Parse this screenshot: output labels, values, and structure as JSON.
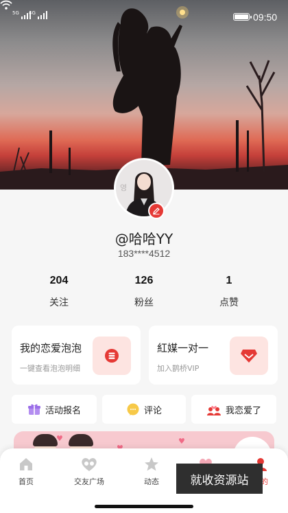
{
  "status_bar": {
    "network_1": "5G",
    "network_2": "4G",
    "time": "09:50"
  },
  "profile": {
    "username": "@哈哈YY",
    "phone": "183****4512"
  },
  "stats": [
    {
      "value": "204",
      "label": "关注"
    },
    {
      "value": "126",
      "label": "粉丝"
    },
    {
      "value": "1",
      "label": "点赞"
    }
  ],
  "cards": [
    {
      "title": "我的恋爱泡泡",
      "subtitle": "一键查看泡泡明细",
      "icon": "coin-stack-icon"
    },
    {
      "title": "紅媒一对一",
      "subtitle": "加入鹊桥VIP",
      "icon": "gem-icon"
    }
  ],
  "actions": [
    {
      "label": "活动报名",
      "icon": "gift-icon"
    },
    {
      "label": "评论",
      "icon": "chat-bubble-icon"
    },
    {
      "label": "我恋爱了",
      "icon": "couple-heart-icon"
    }
  ],
  "tabs": [
    {
      "label": "首页",
      "icon": "home-icon"
    },
    {
      "label": "交友广场",
      "icon": "social-plaza-icon"
    },
    {
      "label": "动态",
      "icon": "star-icon"
    },
    {
      "label": "",
      "icon": "heart-icon"
    },
    {
      "label": "我的",
      "icon": "person-icon",
      "active": true
    }
  ],
  "watermark": "就收资源站",
  "colors": {
    "accent": "#e53935",
    "card_icon_bg": "#fde4e1",
    "page_bg": "#f6f6f6"
  }
}
